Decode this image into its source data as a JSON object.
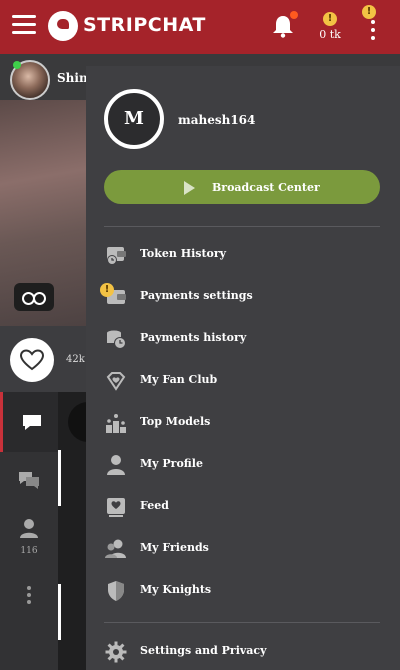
{
  "header": {
    "brand": "STRIPCHAT",
    "tokens": "0 tk",
    "warning_mark": "!",
    "colors": {
      "bar": "#a5232a",
      "notification_dot": "#ff5a1f",
      "warning": "#f3c244"
    }
  },
  "stream": {
    "streamer_name": "Shin",
    "favorites_count": "42k",
    "chat_users_count": "116"
  },
  "drawer": {
    "avatar_initial": "M",
    "username": "mahesh164",
    "broadcast_label": "Broadcast Center",
    "broadcast_color": "#7b9a3d",
    "items": [
      {
        "label": "Token History",
        "icon": "wallet-clock-icon"
      },
      {
        "label": "Payments settings",
        "icon": "wallet-icon",
        "warning": "!"
      },
      {
        "label": "Payments history",
        "icon": "coins-clock-icon"
      },
      {
        "label": "My Fan Club",
        "icon": "heart-diamond-icon"
      },
      {
        "label": "Top Models",
        "icon": "ranking-stars-icon"
      },
      {
        "label": "My Profile",
        "icon": "person-icon"
      },
      {
        "label": "Feed",
        "icon": "feed-heart-icon"
      },
      {
        "label": "My Friends",
        "icon": "friends-icon"
      },
      {
        "label": "My Knights",
        "icon": "shield-icon"
      },
      {
        "label": "Settings and Privacy",
        "icon": "gear-icon"
      }
    ]
  }
}
